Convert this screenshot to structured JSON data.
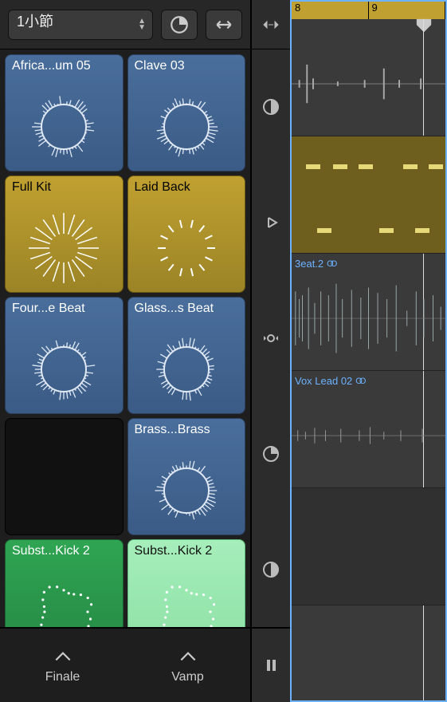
{
  "toolbar": {
    "quantize_label": "1小節"
  },
  "cells": [
    {
      "label": "Africa...um 05",
      "color": "blue"
    },
    {
      "label": "Clave 03",
      "color": "blue"
    },
    {
      "label": "Full Kit",
      "color": "yellow"
    },
    {
      "label": "Laid Back",
      "color": "yellow"
    },
    {
      "label": "Four...e Beat",
      "color": "blue"
    },
    {
      "label": "Glass...s Beat",
      "color": "blue"
    },
    {
      "label": "",
      "color": "empty"
    },
    {
      "label": "Brass...Brass",
      "color": "blue"
    },
    {
      "label": "Subst...Kick 2",
      "color": "green-dark"
    },
    {
      "label": "Subst...Kick 2",
      "color": "green-light"
    }
  ],
  "bottom": {
    "left_label": "Finale",
    "right_label": "Vamp"
  },
  "ruler": {
    "marks": [
      "8",
      "9"
    ]
  },
  "tracks": [
    {
      "name": "",
      "type": "wave"
    },
    {
      "name": "",
      "type": "midi"
    },
    {
      "name": "3eat.2",
      "loop": true,
      "type": "wave"
    },
    {
      "name": "Vox Lead 02",
      "loop": true,
      "type": "wave"
    },
    {
      "name": "",
      "type": "empty"
    }
  ],
  "mid_icons": [
    "zoom-horiz-icon",
    "half-moon-icon",
    "play-small-icon",
    "nudge-icon",
    "pie-icon",
    "half-moon-icon",
    "pause-icon"
  ]
}
